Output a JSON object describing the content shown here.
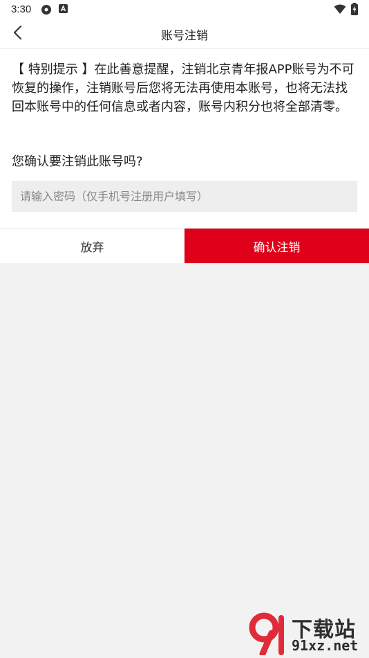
{
  "status_bar": {
    "time": "3:30",
    "icons": [
      "settings-gear-icon",
      "a-notification-icon",
      "wifi-icon",
      "battery-icon"
    ]
  },
  "header": {
    "title": "账号注销",
    "back_icon": "chevron-left-icon"
  },
  "notice": {
    "text": "【 特别提示 】在此善意提醒，注销北京青年报APP账号为不可恢复的操作，注销账号后您将无法再使用本账号，也将无法找回本账号中的任何信息或者内容，账号内积分也将全部清零。"
  },
  "form": {
    "question": "您确认要注销此账号吗?",
    "password_placeholder": "请输入密码（仅手机号注册用户填写）",
    "password_value": ""
  },
  "actions": {
    "cancel_label": "放弃",
    "confirm_label": "确认注销"
  },
  "watermark": {
    "line1": "下载站",
    "line2": "91xz.net"
  },
  "colors": {
    "accent": "#df0019",
    "background": "#f2f2f2",
    "surface": "#ffffff"
  }
}
